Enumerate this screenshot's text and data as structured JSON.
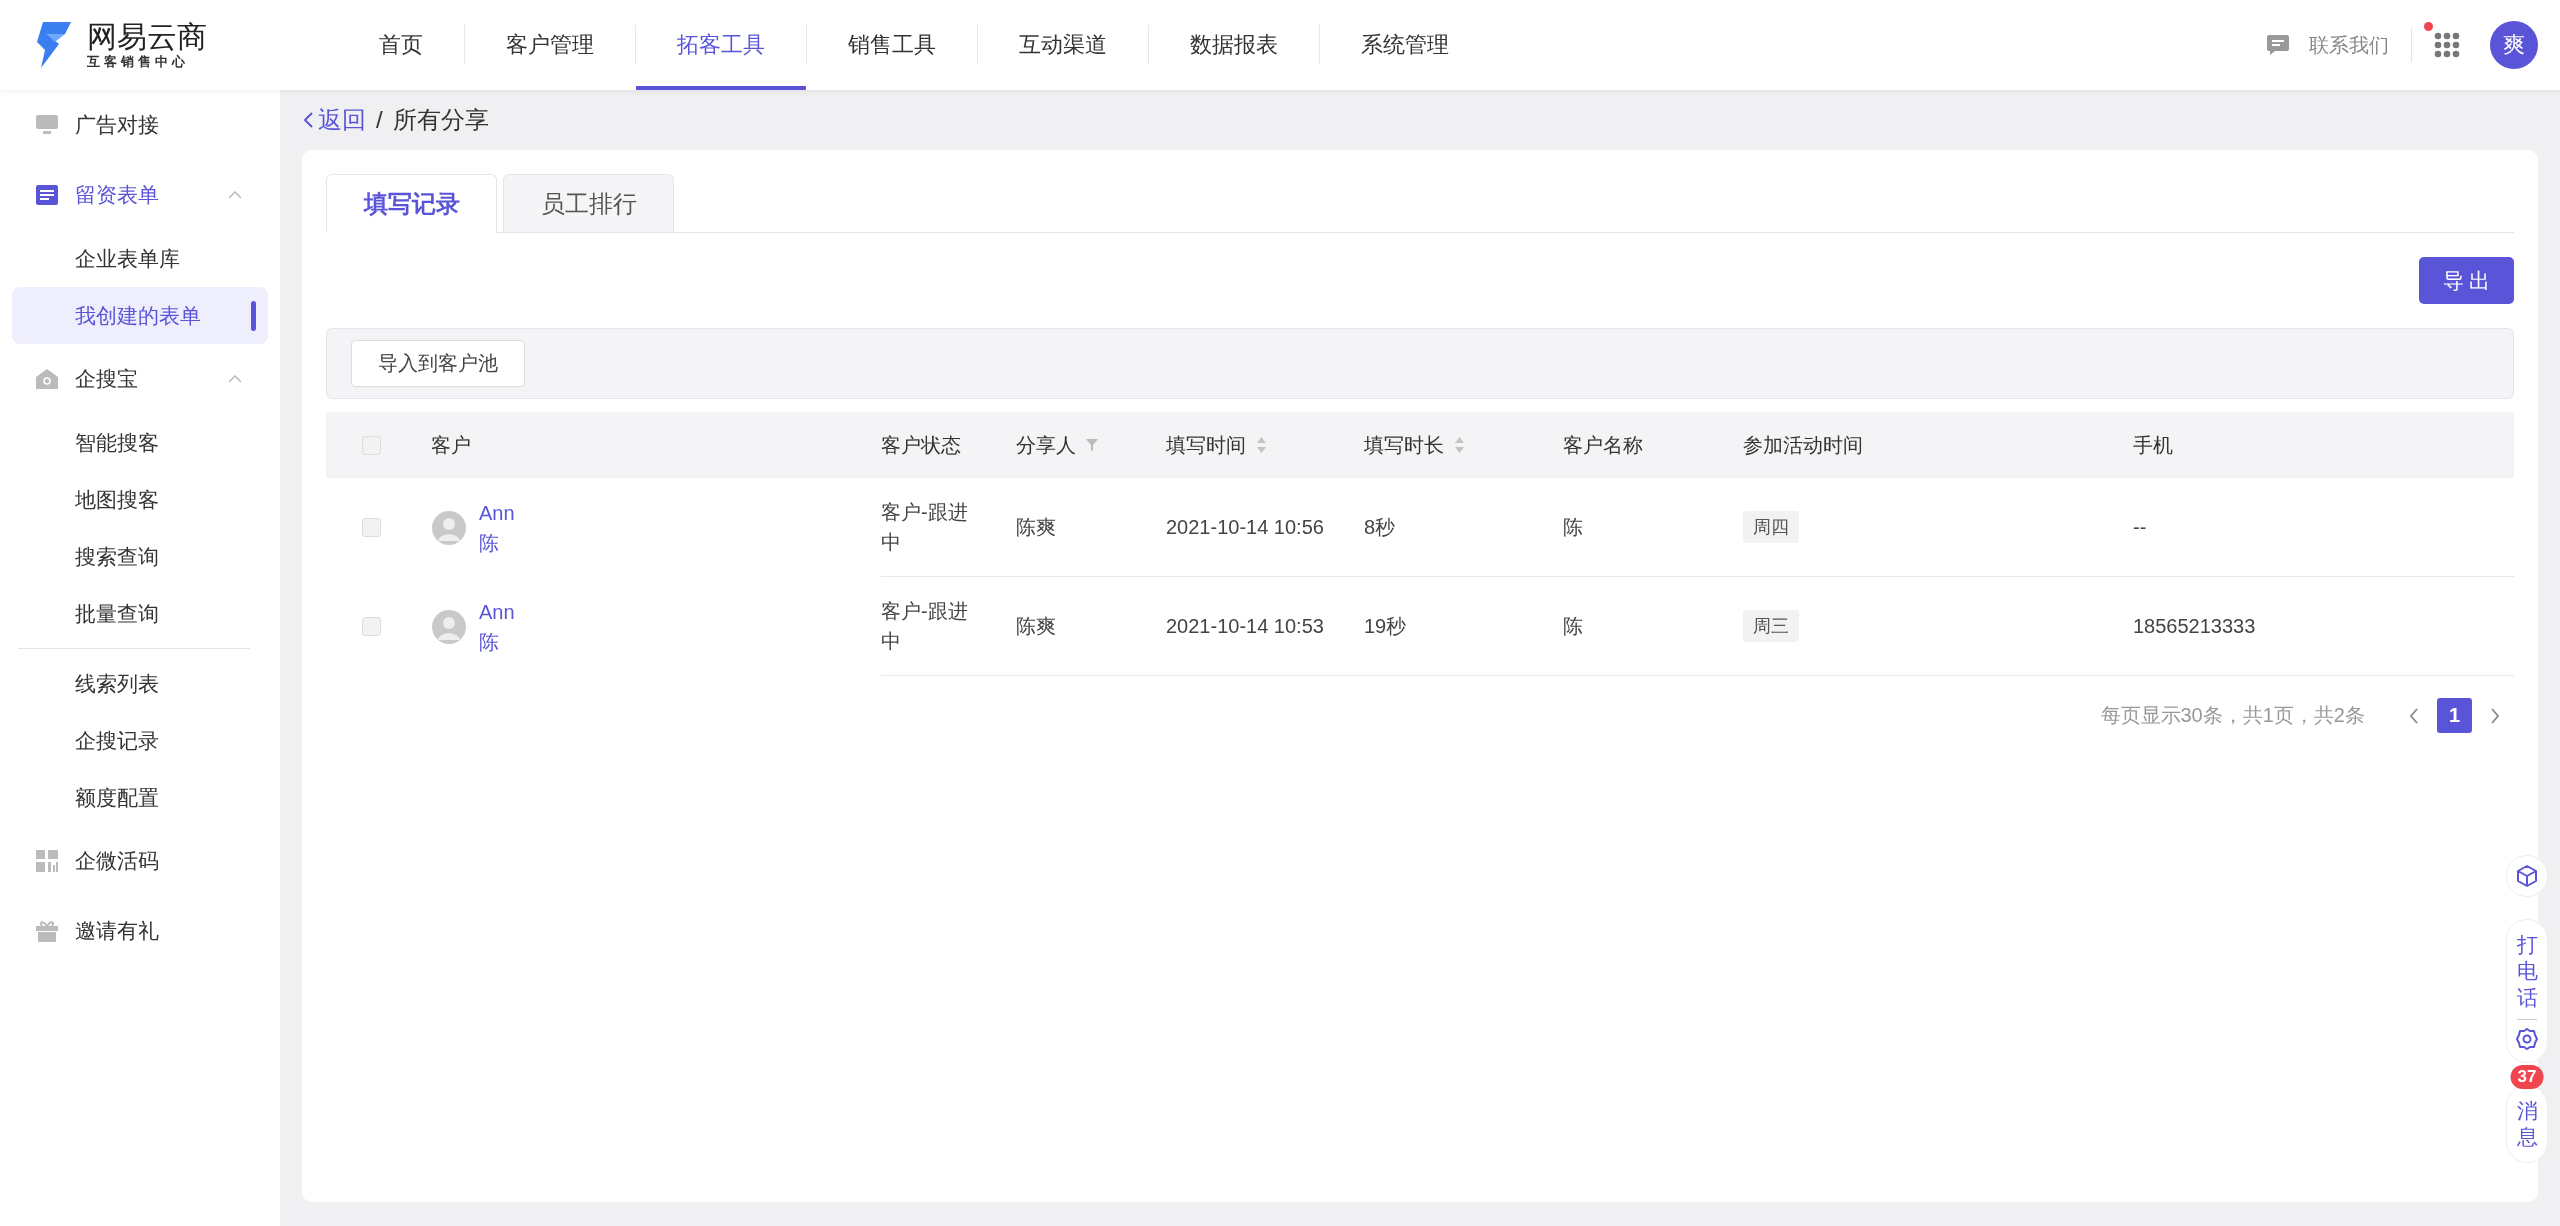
{
  "header": {
    "logo_title": "网易云商",
    "logo_subtitle": "互客销售中心",
    "nav": [
      {
        "label": "首页",
        "selected": false
      },
      {
        "label": "客户管理",
        "selected": false
      },
      {
        "label": "拓客工具",
        "selected": true
      },
      {
        "label": "销售工具",
        "selected": false
      },
      {
        "label": "互动渠道",
        "selected": false
      },
      {
        "label": "数据报表",
        "selected": false
      },
      {
        "label": "系统管理",
        "selected": false
      }
    ],
    "contact": "联系我们",
    "apps_notification": true,
    "avatar": "爽"
  },
  "sidebar": {
    "items": [
      {
        "label": "广告对接",
        "selected": false
      },
      {
        "label": "留资表单",
        "selected": true,
        "expanded": true,
        "children": [
          {
            "label": "企业表单库",
            "selected": false,
            "separator_above": false
          },
          {
            "label": "我创建的表单",
            "selected": true,
            "separator_above": false
          }
        ]
      },
      {
        "label": "企搜宝",
        "selected": false,
        "expanded": true,
        "children": [
          {
            "label": "智能搜客",
            "selected": false,
            "separator_above": false
          },
          {
            "label": "地图搜客",
            "selected": false,
            "separator_above": false
          },
          {
            "label": "搜索查询",
            "selected": false,
            "separator_above": false
          },
          {
            "label": "批量查询",
            "selected": false,
            "separator_above": false
          },
          {
            "label": "线索列表",
            "selected": false,
            "separator_above": true
          },
          {
            "label": "企搜记录",
            "selected": false,
            "separator_above": false
          },
          {
            "label": "额度配置",
            "selected": false,
            "separator_above": false
          }
        ]
      },
      {
        "label": "企微活码",
        "selected": false
      },
      {
        "label": "邀请有礼",
        "selected": false
      }
    ]
  },
  "breadcrumb": {
    "back": "返回",
    "separator": "/",
    "current": "所有分享"
  },
  "tabs": [
    {
      "label": "填写记录",
      "selected": true
    },
    {
      "label": "员工排行",
      "selected": false
    }
  ],
  "export_button": "导 出",
  "toolbar": {
    "import_button": "导入到客户池"
  },
  "table": {
    "select_all_checked": false,
    "columns": [
      {
        "label": "客户",
        "kind": "plain"
      },
      {
        "label": "客户状态",
        "kind": "plain"
      },
      {
        "label": "分享人",
        "kind": "filter"
      },
      {
        "label": "填写时间",
        "kind": "sortable"
      },
      {
        "label": "填写时长",
        "kind": "sortable"
      },
      {
        "label": "客户名称",
        "kind": "plain"
      },
      {
        "label": "参加活动时间",
        "kind": "plain"
      },
      {
        "label": "手机",
        "kind": "plain"
      }
    ],
    "rows": [
      {
        "checked": false,
        "customer": "Ann",
        "customer_sub": "陈",
        "status": "客户-跟进中",
        "sharer": "陈爽",
        "fill_time": "2021-10-14 10:56",
        "duration": "8秒",
        "customer_name": "陈",
        "activity_time": "周四",
        "phone": "--"
      },
      {
        "checked": false,
        "customer": "Ann",
        "customer_sub": "陈",
        "status": "客户-跟进中",
        "sharer": "陈爽",
        "fill_time": "2021-10-14 10:53",
        "duration": "19秒",
        "customer_name": "陈",
        "activity_time": "周三",
        "phone": "18565213333"
      }
    ]
  },
  "pagination": {
    "summary": "每页显示30条，共1页，共2条",
    "pages": [
      {
        "label": "1",
        "selected": true
      }
    ]
  },
  "float_bar": {
    "call_label": "打电话",
    "messages_label": "消息",
    "messages_badge": "37"
  }
}
